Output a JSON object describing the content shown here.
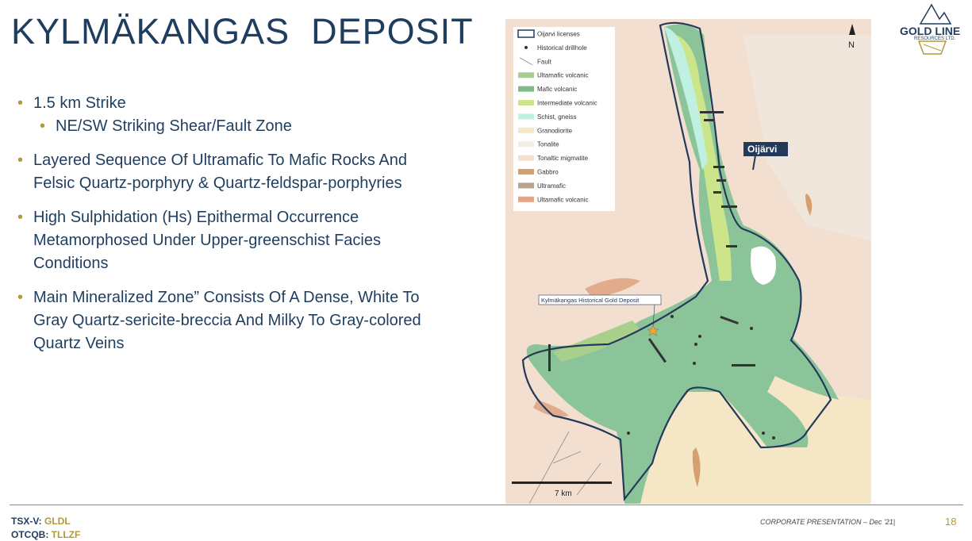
{
  "slide": {
    "title": "KYLMÄKANGAS  DEPOSIT",
    "page_number": "18",
    "footer_note": "CORPORATE PRESENTATION – Dec '21|"
  },
  "bullets": [
    {
      "text": "1.5 km Strike",
      "sub": "NE/SW Striking Shear/Fault Zone"
    },
    {
      "line1": "Layered Sequence Of Ultramafic To Mafic Rocks And",
      "line2": "Felsic Quartz-porphyry & Quartz-feldspar-porphyries"
    },
    {
      "line1": "High Sulphidation (Hs) Epithermal Occurrence",
      "line2": "Metamorphosed Under Upper-greenschist Facies",
      "line3": "Conditions"
    },
    {
      "line1": "Main Mineralized Zone” Consists Of A Dense, White To",
      "line2": "Gray Quartz-sericite-breccia And Milky To Gray-colored",
      "line3": "Quartz Veins"
    }
  ],
  "tickers": [
    {
      "exchange": "TSX-V: ",
      "symbol": "GLDL"
    },
    {
      "exchange": "OTCQB: ",
      "symbol": "TLLZF"
    }
  ],
  "logo": {
    "line1": "GOLD LINE",
    "line2": "RESOURCES LTD."
  },
  "map": {
    "north_label": "N",
    "scale_label": "7 km",
    "place_label": "Oijärvi",
    "deposit_label": "Kylmäkangas Historical Gold Deposit",
    "legend": [
      {
        "label": "Oijarvi licenses",
        "color": "#ffffff",
        "kind": "box"
      },
      {
        "label": "Historical drillhole",
        "color": "#333333",
        "kind": "dot"
      },
      {
        "label": "Fault",
        "color": "#777777",
        "kind": "line"
      },
      {
        "label": "Ultamafic volcanic",
        "color": "#a8cf8c"
      },
      {
        "label": "Mafic volcanic",
        "color": "#7fba8a"
      },
      {
        "label": "Intermediate volcanic",
        "color": "#cde58a"
      },
      {
        "label": "Schist, gneiss",
        "color": "#bff0e2"
      },
      {
        "label": "Granodiorite",
        "color": "#f5e6c6"
      },
      {
        "label": "Tonalite",
        "color": "#f4ede3"
      },
      {
        "label": "Tonaltic migmatite",
        "color": "#f3dfcf"
      },
      {
        "label": "Gabbro",
        "color": "#d6a06e"
      },
      {
        "label": "Ultramafic",
        "color": "#b9a48e"
      },
      {
        "label": "Ultamafic volcanic",
        "color": "#e6a58a"
      }
    ],
    "colors": {
      "background": "#f3dfcf",
      "license": "#233a5a",
      "mafic": "#8cc49a",
      "schist": "#bff0e2",
      "granodiorite": "#f5e6c6"
    }
  }
}
